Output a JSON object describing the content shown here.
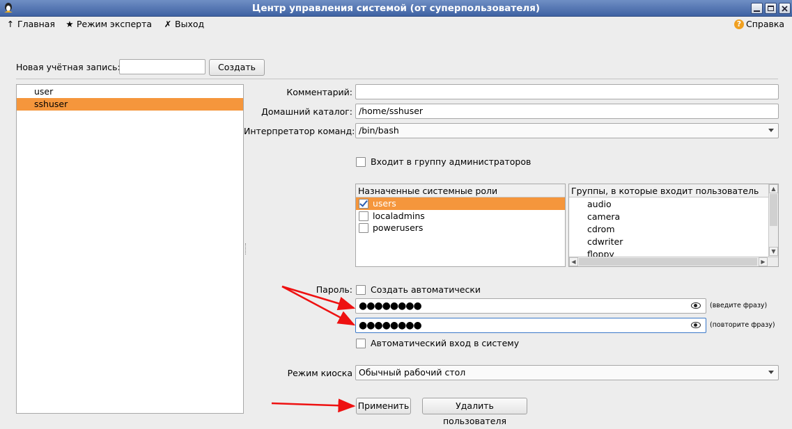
{
  "window": {
    "title": "Центр управления системой (от суперпользователя)"
  },
  "menu": {
    "home": "Главная",
    "expert": "Режим эксперта",
    "exit": "Выход",
    "help": "Справка"
  },
  "new_account": {
    "label": "Новая учётная запись:",
    "value": "",
    "create_button": "Создать"
  },
  "users": [
    "user",
    "sshuser"
  ],
  "selected_user": "sshuser",
  "form": {
    "comment_label": "Комментарий:",
    "comment_value": "",
    "home_label": "Домашний каталог:",
    "home_value": "/home/sshuser",
    "shell_label": "Интерпретатор команд:",
    "shell_value": "/bin/bash",
    "admin_group_label": "Входит в группу администраторов",
    "admin_group_checked": false
  },
  "roles": {
    "header": "Назначенные системные роли",
    "items": [
      {
        "label": "users",
        "checked": true,
        "selected": true
      },
      {
        "label": "localadmins",
        "checked": false,
        "selected": false
      },
      {
        "label": "powerusers",
        "checked": false,
        "selected": false
      }
    ]
  },
  "groups": {
    "header": "Группы, в которые входит пользователь",
    "items": [
      "audio",
      "camera",
      "cdrom",
      "cdwriter",
      "floppy"
    ]
  },
  "password": {
    "label": "Пароль:",
    "auto_label": "Создать автоматически",
    "auto_checked": false,
    "field1_value": "●●●●●●●●",
    "field1_hint": "(введите фразу)",
    "field2_value": "●●●●●●●●",
    "field2_hint": "(повторите фразу)",
    "autologin_label": "Автоматический вход в систему",
    "autologin_checked": false
  },
  "kiosk": {
    "label": "Режим киоска",
    "value": "Обычный рабочий стол"
  },
  "actions": {
    "apply": "Применить",
    "delete": "Удалить пользователя"
  },
  "colors": {
    "titlebar": "#4a6aa8",
    "selection": "#f5963c",
    "annotation_arrow": "#ee1111"
  }
}
